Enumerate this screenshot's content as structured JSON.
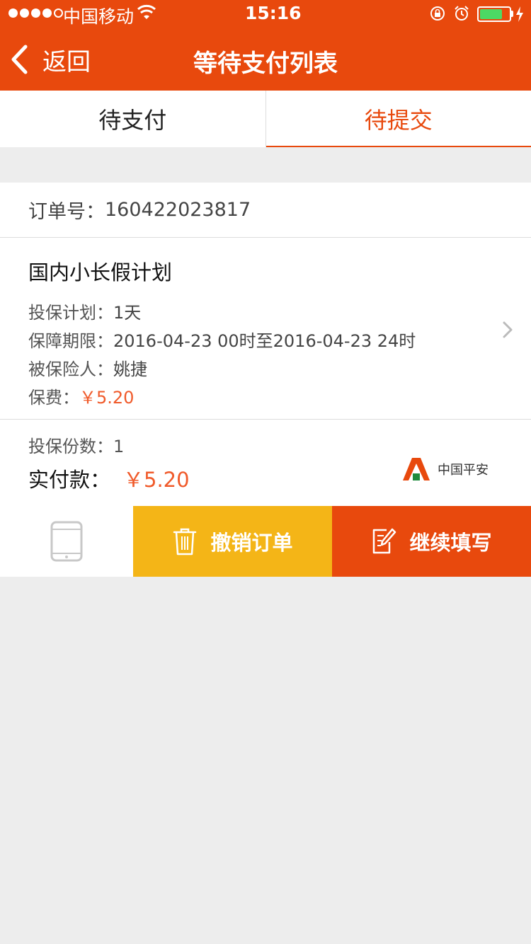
{
  "status_bar": {
    "carrier": "中国移动",
    "time": "15:16",
    "battery_fraction": 0.78
  },
  "nav": {
    "back_label": "返回",
    "title": "等待支付列表"
  },
  "tabs": [
    {
      "label": "待支付",
      "active": false
    },
    {
      "label": "待提交",
      "active": true
    }
  ],
  "order": {
    "order_no_label": "订单号：",
    "order_no": "160422023817",
    "product_name": "国内小长假计划",
    "plan_label": "投保计划：",
    "plan_value": "1天",
    "period_label": "保障期限：",
    "period_value": "2016-04-23 00时至2016-04-23 24时",
    "insured_label": "被保险人：",
    "insured_value": "姚捷",
    "premium_label": "保费：",
    "premium_value": "￥5.20",
    "qty_label": "投保份数：",
    "qty_value": "1",
    "paid_label": "实付款：",
    "paid_value": "￥5.20",
    "insurer_name": "中国平安"
  },
  "actions": {
    "cancel_label": "撤销订单",
    "continue_label": "继续填写"
  },
  "colors": {
    "brand": "#e8490d",
    "cancel": "#f4b517",
    "price": "#f05a2a",
    "battery": "#4cd964"
  },
  "icons": [
    "wifi-icon",
    "rotation-lock-icon",
    "alarm-icon",
    "battery-icon",
    "charging-bolt-icon",
    "back-chevron-icon",
    "chevron-right-icon",
    "ping-an-logo",
    "tablet-icon",
    "trash-icon",
    "edit-icon"
  ]
}
